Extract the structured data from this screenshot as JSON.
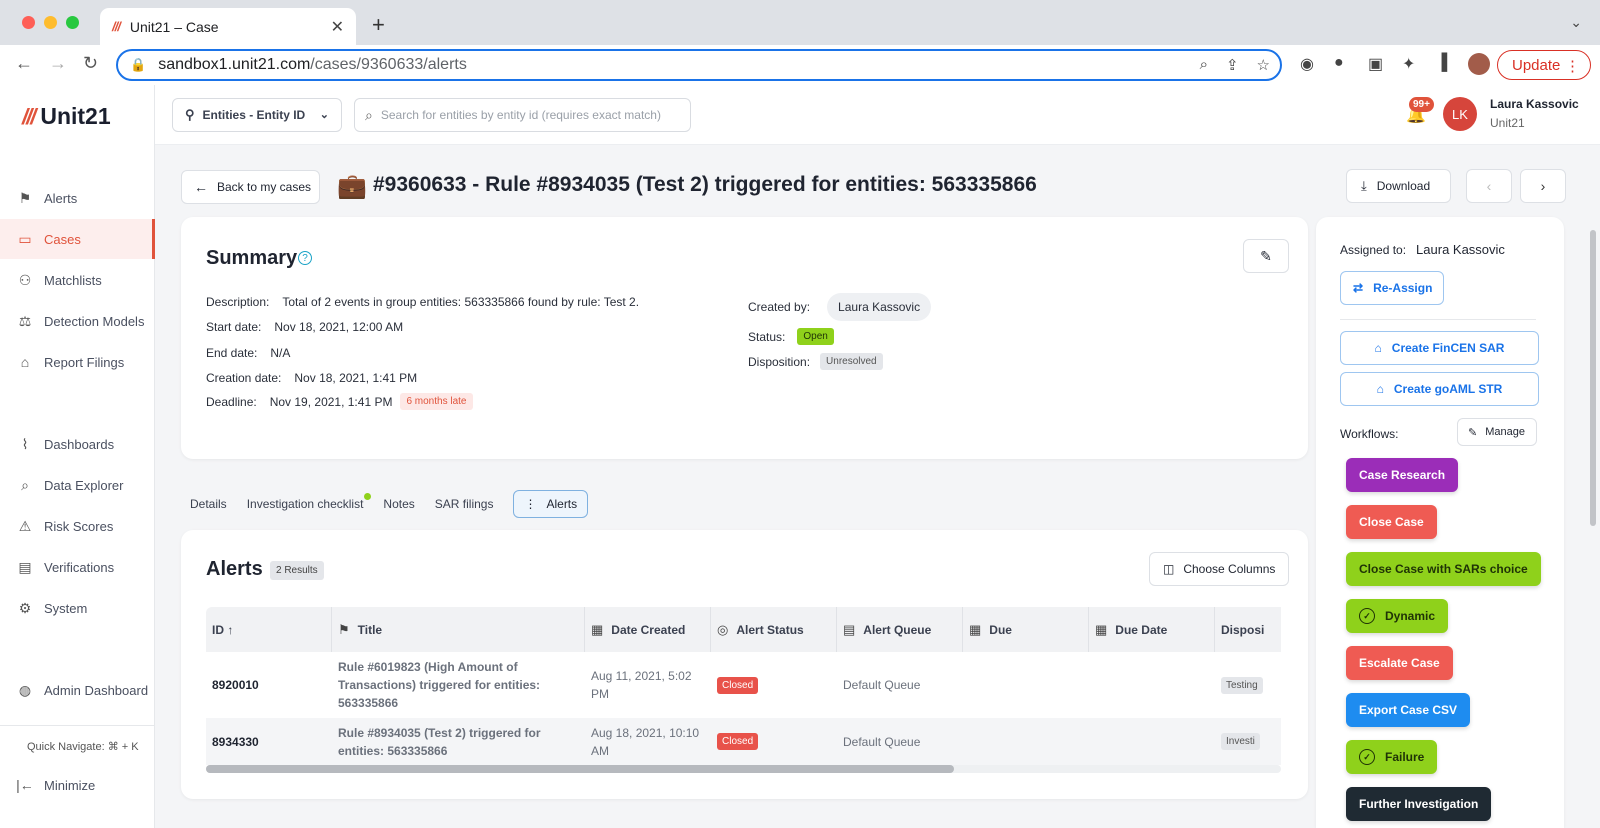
{
  "browser": {
    "tab_title": "Unit21 – Case",
    "favicon": "///",
    "url_host": "sandbox1.unit21.com",
    "url_path": "/cases/9360633/alerts",
    "update_label": "Update"
  },
  "app": {
    "logo_text": "Unit21",
    "entity_select": "Entities - Entity ID",
    "search_placeholder": "Search for entities by entity id (requires exact match)",
    "notif_badge": "99+",
    "user_initials": "LK",
    "user_name": "Laura Kassovic",
    "user_org": "Unit21"
  },
  "sidebar": {
    "items": [
      {
        "label": "Alerts",
        "icon": "flag-icon"
      },
      {
        "label": "Cases",
        "icon": "briefcase-icon"
      },
      {
        "label": "Matchlists",
        "icon": "user-list-icon"
      },
      {
        "label": "Detection Models",
        "icon": "scale-icon"
      },
      {
        "label": "Report Filings",
        "icon": "bank-icon"
      },
      {
        "label": "Dashboards",
        "icon": "chart-icon"
      },
      {
        "label": "Data Explorer",
        "icon": "search-table-icon"
      },
      {
        "label": "Risk Scores",
        "icon": "warning-icon"
      },
      {
        "label": "Verifications",
        "icon": "id-card-icon"
      },
      {
        "label": "System",
        "icon": "gear-icon"
      },
      {
        "label": "Admin Dashboard",
        "icon": "globe-icon"
      }
    ],
    "quick_navigate": "Quick Navigate: ⌘ + K",
    "minimize": "Minimize"
  },
  "header": {
    "back_label": "Back to my cases",
    "case_title": "#9360633 - Rule #8934035 (Test 2) triggered for entities: 563335866",
    "download_label": "Download"
  },
  "summary": {
    "title": "Summary",
    "description_label": "Description:",
    "description": "Total of 2 events in group entities: 563335866 found by rule: Test 2.",
    "start_label": "Start date:",
    "start": "Nov 18, 2021, 12:00 AM",
    "end_label": "End date:",
    "end": "N/A",
    "creation_label": "Creation date:",
    "creation": "Nov 18, 2021, 1:41 PM",
    "deadline_label": "Deadline:",
    "deadline": "Nov 19, 2021, 1:41 PM",
    "late_badge": "6 months late",
    "created_by_label": "Created by:",
    "created_by": "Laura Kassovic",
    "status_label": "Status:",
    "status": "Open",
    "disposition_label": "Disposition:",
    "disposition": "Unresolved"
  },
  "tabs": [
    "Details",
    "Investigation checklist",
    "Notes",
    "SAR filings",
    "Alerts"
  ],
  "alerts": {
    "title": "Alerts",
    "count": "2 Results",
    "choose_columns": "Choose Columns",
    "columns": [
      "ID ↑",
      "Title",
      "Date Created",
      "Alert Status",
      "Alert Queue",
      "Due",
      "Due Date",
      "Disposi"
    ],
    "rows": [
      {
        "id": "8920010",
        "title": "Rule #6019823 (High Amount of Transactions) triggered for entities: 563335866",
        "date": "Aug 11, 2021, 5:02 PM",
        "status": "Closed",
        "queue": "Default Queue",
        "disposition": "Testing"
      },
      {
        "id": "8934330",
        "title": "Rule #8934035 (Test 2) triggered for entities: 563335866",
        "date": "Aug 18, 2021, 10:10 AM",
        "status": "Closed",
        "queue": "Default Queue",
        "disposition": "Investi"
      }
    ]
  },
  "right_panel": {
    "assigned_label": "Assigned to:",
    "assigned_to": "Laura Kassovic",
    "reassign": "Re-Assign",
    "fincen": "Create FinCEN SAR",
    "goaml": "Create goAML STR",
    "workflows_label": "Workflows:",
    "manage": "Manage",
    "workflows": [
      {
        "label": "Case Research",
        "color": "#9b2db8",
        "text_color": "#ffffff"
      },
      {
        "label": "Close Case",
        "color": "#ef5b53",
        "text_color": "#ffffff"
      },
      {
        "label": "Close Case with SARs choice",
        "color": "#8fd11b",
        "text_color": "#1f3306"
      },
      {
        "label": "Dynamic",
        "color": "#8fd11b",
        "text_color": "#1f3306",
        "icon": "check-circle-icon"
      },
      {
        "label": "Escalate Case",
        "color": "#ef5b53",
        "text_color": "#ffffff"
      },
      {
        "label": "Export Case CSV",
        "color": "#1e8cf0",
        "text_color": "#ffffff"
      },
      {
        "label": "Failure",
        "color": "#8fd11b",
        "text_color": "#1f3306",
        "icon": "check-circle-icon"
      },
      {
        "label": "Further Investigation",
        "color": "#1f2a33",
        "text_color": "#ffffff"
      }
    ]
  }
}
